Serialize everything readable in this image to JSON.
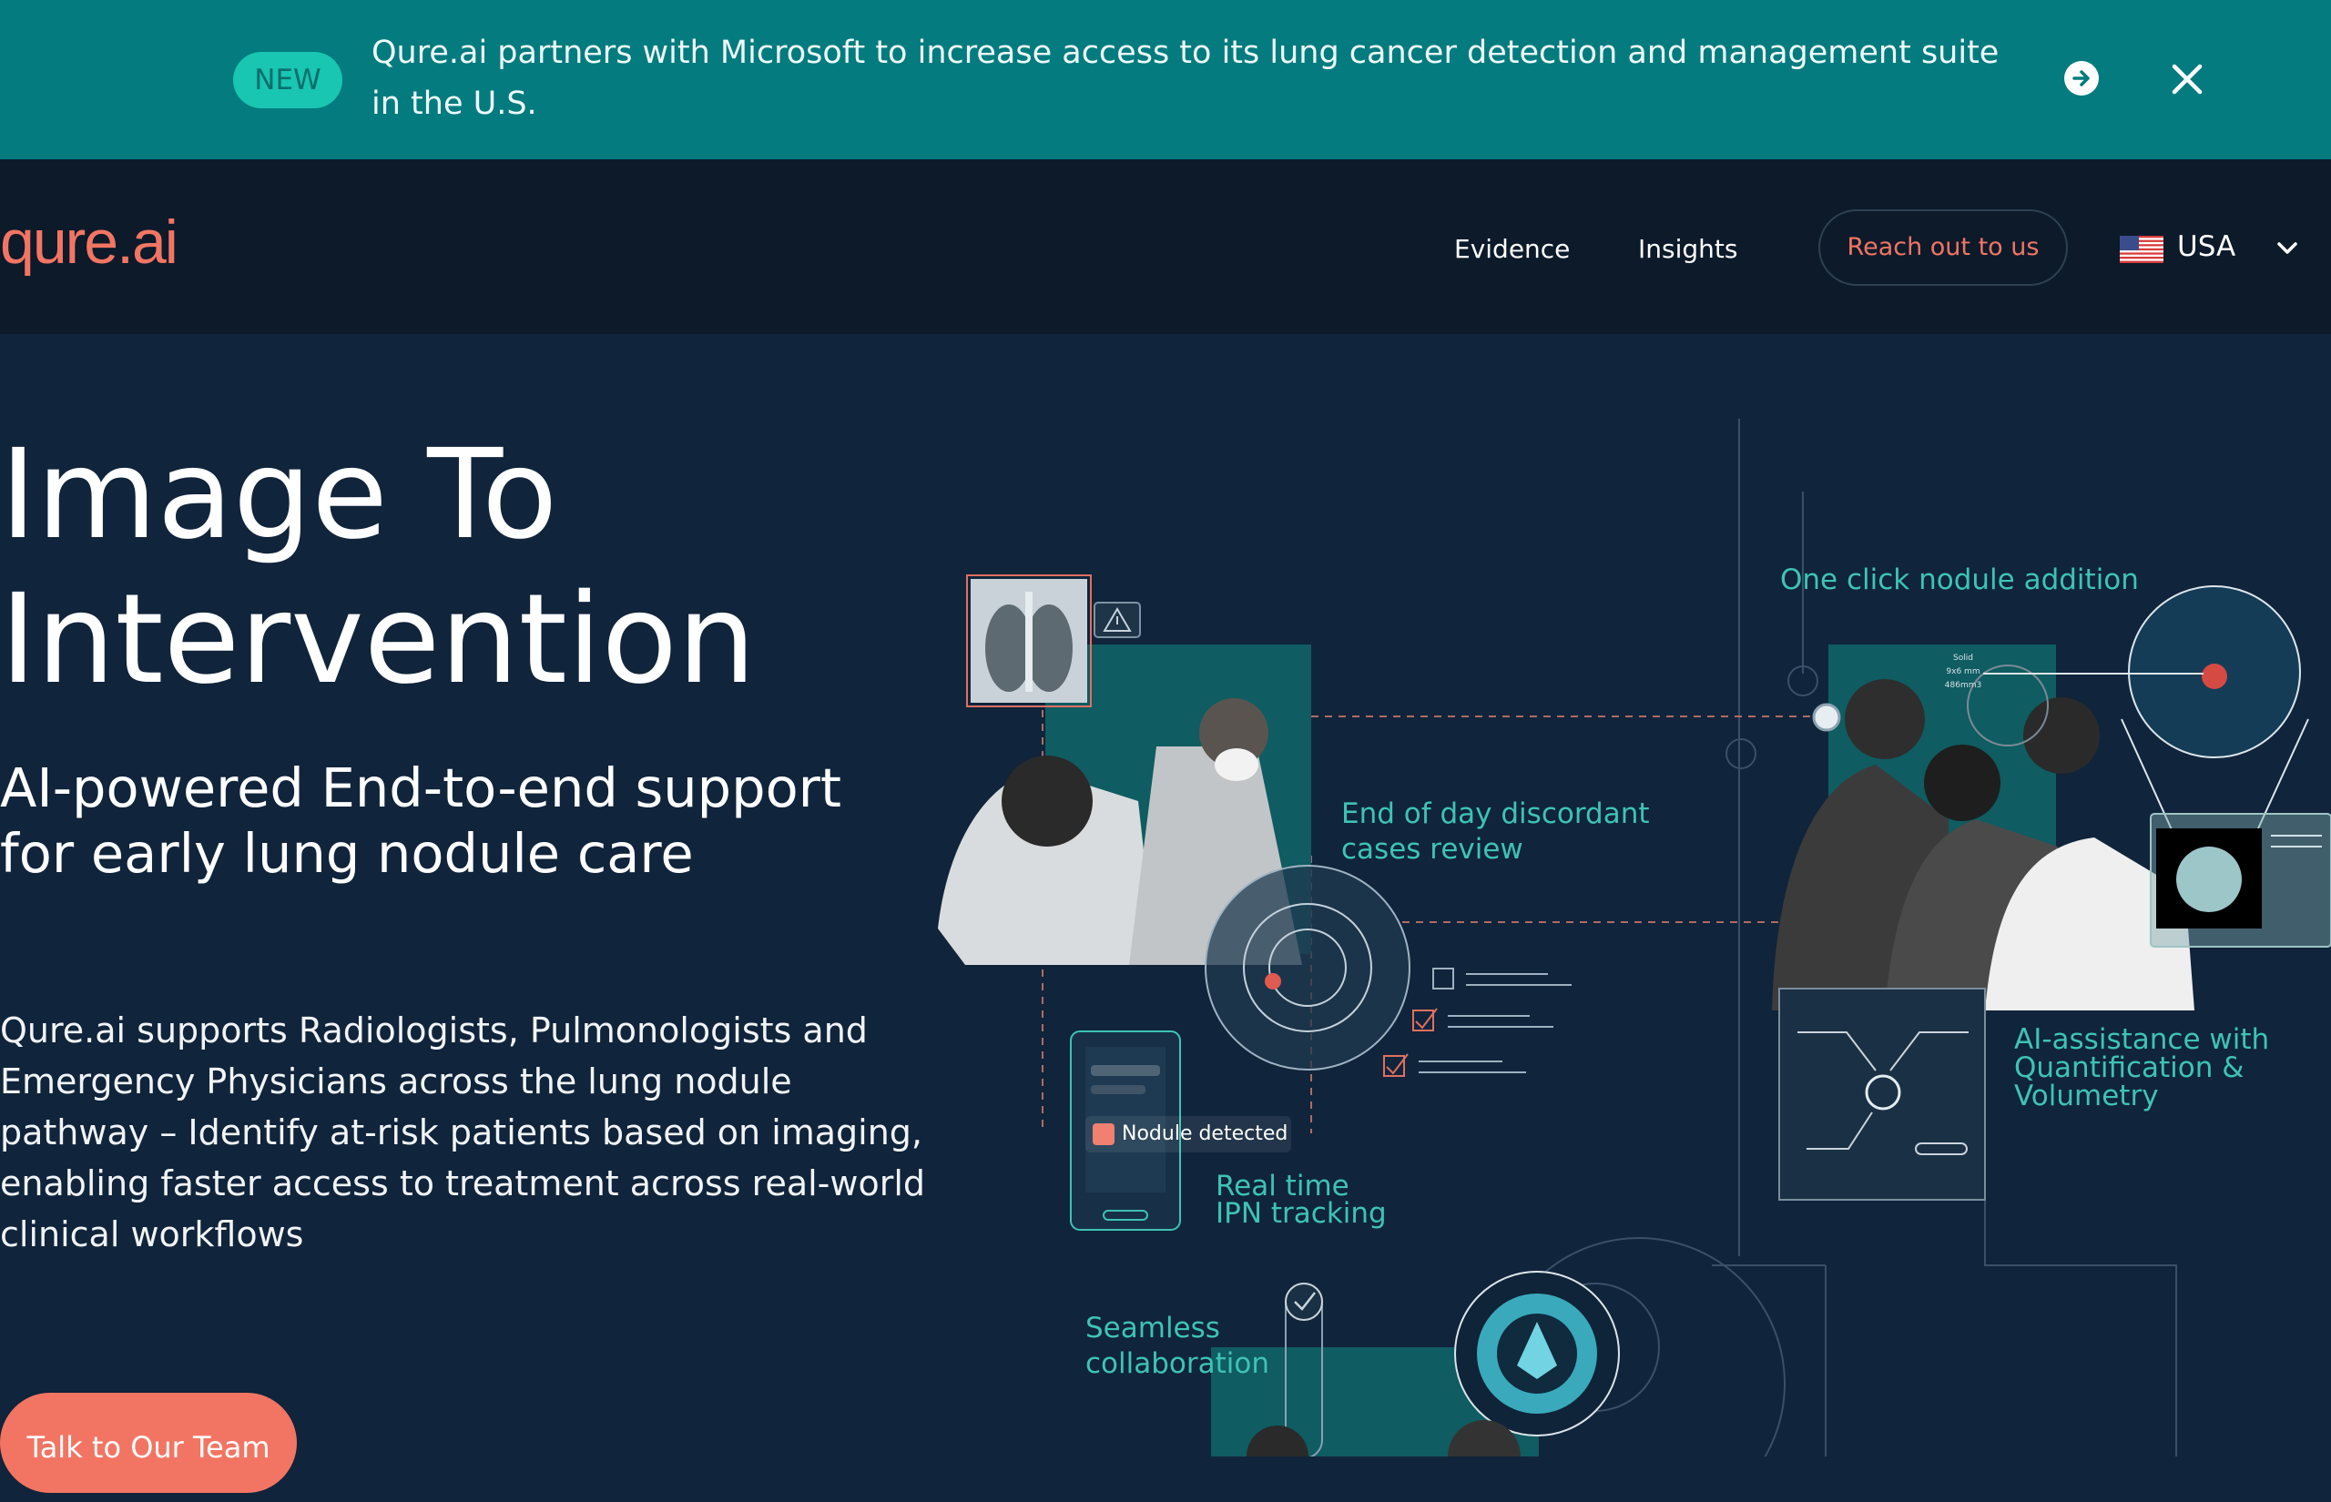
{
  "banner": {
    "badge": "NEW",
    "text": "Qure.ai partners with Microsoft to increase access to its lung cancer detection and management suite in the U.S.",
    "arrow_icon": "arrow-right-circle-icon",
    "close_icon": "close-icon"
  },
  "nav": {
    "logo": "qure.ai",
    "links": [
      "Evidence",
      "Insights"
    ],
    "cta": "Reach out to us",
    "country": "USA"
  },
  "hero": {
    "title_line1": "Image To",
    "title_line2": "Intervention",
    "subtitle": "AI-powered End-to-end support for early lung nodule care",
    "description": "Qure.ai supports Radiologists, Pulmonologists and Emergency Physicians across the lung nodule pathway – Identify at-risk patients based on imaging, enabling faster access to treatment across real-world clinical workflows",
    "cta": "Talk to Our Team"
  },
  "illustration": {
    "labels": {
      "one_click": "One click nodule addition",
      "end_of_day_1": "End of day discordant",
      "end_of_day_2": "cases review",
      "ai_1": "AI-assistance with",
      "ai_2": "Quantification &",
      "ai_3": "Volumetry",
      "ipn_1": "Real time",
      "ipn_2": "IPN tracking",
      "seamless_1": "Seamless",
      "seamless_2": "collaboration"
    },
    "nodule_tag": "Nodule detected",
    "ct_annotation": [
      "Solid",
      "9x6 mm",
      "486mm3"
    ]
  },
  "colors": {
    "banner_bg": "#047b7f",
    "badge_bg": "#18c6b2",
    "nav_bg": "#0c1a2a",
    "page_bg": "#10243b",
    "accent": "#f27563",
    "teal_label": "#3ec3b4"
  }
}
